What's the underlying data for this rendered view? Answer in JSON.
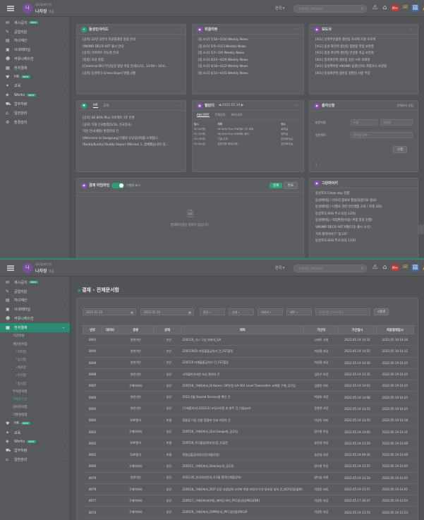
{
  "top": {
    "org": "재무통제/인증",
    "user_name": "나차장",
    "user_rank": "차장",
    "avatar_text": "나",
    "lang": "한국",
    "search_placeholder": "검색어를 입력하세요",
    "badge_count": "99+"
  },
  "sidebar1": [
    {
      "icon": "board-icon",
      "glyph": "✉",
      "label": "게시공지",
      "new": "NEW"
    },
    {
      "icon": "pencil-icon",
      "glyph": "✎",
      "label": "공업지원",
      "new": ""
    },
    {
      "icon": "chart-icon",
      "glyph": "▤",
      "label": "자녀계산",
      "new": ""
    },
    {
      "icon": "folder-icon",
      "glyph": "▣",
      "label": "사내레터널",
      "new": ""
    },
    {
      "icon": "people-icon",
      "glyph": "☻",
      "label": "커뮤니케이션",
      "new": ""
    },
    {
      "icon": "doc-icon",
      "glyph": "▦",
      "label": "전자결재",
      "new": ""
    },
    {
      "icon": "hr-icon",
      "glyph": "♥",
      "label": "HR",
      "new": "NEW"
    },
    {
      "icon": "edu-icon",
      "glyph": "✦",
      "label": "교육",
      "new": ""
    },
    {
      "icon": "works-icon",
      "glyph": "◈",
      "label": "Works",
      "new": "NEW"
    },
    {
      "icon": "car-icon",
      "glyph": "⛟",
      "label": "업무차량",
      "new": ""
    },
    {
      "icon": "building-icon",
      "glyph": "⌂",
      "label": "일반관리",
      "new": ""
    },
    {
      "icon": "settings-icon",
      "glyph": "⚙",
      "label": "환경관리",
      "new": ""
    }
  ],
  "cards": {
    "notice": {
      "title": "동성인사이드",
      "items": [
        "[공지] 22년 상반기 미운올해정 알림 안내",
        "VIKUNR DECO ART 출시 안내",
        "[공지] 다이아트 리뉴얼 안내",
        "[알림] 포장 알림",
        "[Chemical BU] 부산공장 정방 작업 안내(1/11, 13:00~ 16:0...",
        "[공지] 동성테크 Green Board 발행_4월"
      ]
    },
    "weekly": {
      "title": "위클리뷰",
      "items": [
        "[동.A.O] 5/16~5/20 Weekly News",
        "[동.A.O] 5/9~5/13 Weekly News",
        "[동.A.O] 5/2~5/6 Weekly News",
        "[동.A.O] 4/25~4/29 Weekly News",
        "[동.A.O] 4/18~4/22 Weekly News",
        "[동.A.O] 4/11~4/15 Weekly News"
      ]
    },
    "press": {
      "title": "보도사",
      "items": [
        "[보도] 산학부산협력 생산팀 자사팩 지원 프로젝",
        "[보도] 동성 화인텍 생산팀 함정량 작업 보관원",
        "[보도] 동성 화인텍 생산팀 안성용 지금 보관실",
        "[보도] 동성화인텍 생산팀 김선 시유 모바일",
        "[보도] 동성케미칼 VIKUNR 숨결(신뢰) 최종코시 보관원",
        "[보도] 동성화인텍 생산팀 김영일 사용 부양"
      ]
    },
    "hr": {
      "title": "HR",
      "tab1": "HR",
      "tab2": "교육",
      "items": [
        "[공지] SK 80% Plus 프로젝트 T/F 운영",
        "[공지] 직원 인사발령(5/16, 신규입사)",
        "직원 인사(채용) 발령안내 건",
        "[Welcome to Dongsung] 5월의 신규입사자를 소개합니...",
        "[BuddyBuddy] Buddy Report (Mission 1, 함께했습니다) 중..."
      ]
    },
    "schedule": {
      "title": "캘린더",
      "date": "2022.05.19",
      "tabs": [
        "Add OOF",
        "전체일정",
        "회의/교육"
      ],
      "headers": [
        "일시",
        "제목",
        "장소"
      ],
      "rows": [
        [
          "05.19(목)",
          "SK 80% Plus 프로젝트 T/F 회의",
          "회의실"
        ],
        [
          "05.19(목)",
          "SK 80% Plus 프로젝트 회의",
          "회의실"
        ],
        [
          "05.19(목)",
          "기술 주제",
          "본관회의실"
        ],
        [
          "05.20(금)",
          "경영기획 회의(2층)",
          "본관회의실"
        ]
      ]
    },
    "visitor": {
      "title": "출자신청",
      "link": "전체보기 신청",
      "l1": "방문자명",
      "l2": "방문목적",
      "p1": "이름",
      "p2": "업체명",
      "p3": "목적을 입력",
      "submit": "신청",
      "note": "1"
    },
    "approval": {
      "title": "결재 타임라인",
      "toggle_label": "진행중 표시",
      "btn1": "결재",
      "btn2": "완료",
      "empty": "결재대기중인 항목이 없습니다."
    },
    "green": {
      "title": "그린마이키",
      "items": [
        "동성TCS Clean day 진행",
        "동성에이팀 / 리프리 종료로 월동(동절기로 종료)",
        "동성에이팀 / 나행사 관련 안전생활 교육 / 과제 교육)",
        "동성TCS EHS 주소식(등 12차)",
        "동성에이팀 / 작업환경(이용) 위험 알림 진행)",
        "VIKUNR DECO ART 9월(1차) 출시 소식)",
        "가족 행복이야기 \"칭고로\"",
        "동성TCS EHS 주소식(등 11차)"
      ]
    }
  },
  "sidebar2": {
    "top_items": [
      {
        "icon": "board-icon",
        "glyph": "✉",
        "label": "게시공지",
        "new": "NEW"
      },
      {
        "icon": "pencil-icon",
        "glyph": "✎",
        "label": "공업지원",
        "new": ""
      },
      {
        "icon": "chart-icon",
        "glyph": "▤",
        "label": "자녀계산",
        "new": ""
      },
      {
        "icon": "folder-icon",
        "glyph": "▣",
        "label": "사내레터널",
        "new": ""
      },
      {
        "icon": "people-icon",
        "glyph": "☻",
        "label": "커뮤니케이션",
        "new": ""
      }
    ],
    "active": {
      "icon": "doc-icon",
      "glyph": "▦",
      "label": "전자결재"
    },
    "subs": [
      {
        "label": "기안작성",
        "level": 1,
        "green": false
      },
      {
        "label": "개인문서함",
        "level": 1,
        "green": false
      },
      {
        "label": "처리함",
        "level": 2,
        "green": false
      },
      {
        "label": "상신함",
        "level": 2,
        "green": false
      },
      {
        "label": "배포함",
        "level": 2,
        "green": false
      },
      {
        "label": "수신함",
        "level": 2,
        "green": false
      },
      {
        "label": "참시함",
        "level": 2,
        "green": false
      },
      {
        "label": "부서문서함",
        "level": 1,
        "green": false
      },
      {
        "label": "전체문서함",
        "level": 1,
        "green": true
      },
      {
        "label": "감사문서함",
        "level": 1,
        "green": false
      },
      {
        "label": "기본설정함",
        "level": 1,
        "green": false
      }
    ],
    "bottom_items": [
      {
        "icon": "hr-icon",
        "glyph": "♥",
        "label": "HR",
        "new": "NEW"
      },
      {
        "icon": "edu-icon",
        "glyph": "✦",
        "label": "교육",
        "new": ""
      },
      {
        "icon": "works-icon",
        "glyph": "◈",
        "label": "Works",
        "new": "NEW"
      },
      {
        "icon": "car-icon",
        "glyph": "⛟",
        "label": "업무차량",
        "new": ""
      },
      {
        "icon": "building-icon",
        "glyph": "⌂",
        "label": "일반관리",
        "new": ""
      }
    ]
  },
  "doclist": {
    "title": "결재 - 전체문서함",
    "date_from": "2022.01.19",
    "date_to": "2022.05.19",
    "f_type": "종류",
    "f_status": "상태",
    "f_dept": "대외비",
    "f_field": "제목",
    "search_placeholder": "검색어를 입력하세요",
    "search_btn": "검색",
    "headers": [
      "번호",
      "대외비",
      "종류",
      "상태",
      "제목",
      "기안자",
      "기안일시",
      "최종결재일시"
    ],
    "rows": [
      [
        "8091",
        "",
        "일반기안",
        "승인",
        "220519_가스 구입 의뢰서_QA",
        "고재우 사원",
        "2022.05.19 14:31",
        "2022.05.19 14:36"
      ],
      [
        "8090",
        "",
        "일반기안",
        "승인",
        "220519(D) 자동출출금처리 건_FST출장",
        "허성철 과장",
        "2022.05.19 14:25",
        "2022.05.19 14:31"
      ],
      [
        "8089",
        "",
        "일반기안",
        "승인",
        "220519 자재출출금처리 건_FST출장",
        "허성철 과장",
        "2022.05.19 14:30",
        "2022.05.19 14:25"
      ],
      [
        "8088",
        "",
        "일반기안",
        "승인",
        "고객불만처리한 보상 품의의 건",
        "김준우 부장",
        "2022.05.19 13:35",
        "2022.05.19 14:25"
      ],
      [
        "8087",
        "",
        "구매의뢰서",
        "승인",
        "220518_구매의뢰서_IS Korea / OP유정 UA-302 Level Transmitter 교체용 구매_공무팀",
        "김종민 대리",
        "2022.05.19 14:01",
        "2022.05.19 14:25"
      ],
      [
        "8086",
        "",
        "일반기안",
        "승인",
        "2022 4월 Shared Service용 확인 건",
        "박경호 과장",
        "2022.05.19 14:08",
        "2022.05.19 14:25"
      ],
      [
        "8085",
        "",
        "일반기안",
        "승인",
        "[구매품의서] 2022(3) 코딩소모품 외 발주 건_이동part",
        "윤종현 과장",
        "2022.05.19 13:52",
        "2022.05.19 14:25"
      ],
      [
        "8084",
        "",
        "SAP품의",
        "미결",
        "정품류 이동 신용 용품에 인쇄 과정의 건",
        "이상민 대리",
        "2022.05.19 13:50",
        "2022.05.19 14:18"
      ],
      [
        "8083",
        "",
        "구매의뢰서",
        "승인",
        "220516_구매의뢰서_Dial Gauge외_공무팀",
        "정우창 주임",
        "2022.05.19 14:00",
        "2022.05.19 14:11"
      ],
      [
        "8082",
        "",
        "SAP품의",
        "미결",
        "220519_주식출입(외부)인증_유류운",
        "송준영 과장",
        "2022.05.19 13:29",
        "2022.05.19 14:09"
      ],
      [
        "8081",
        "",
        "SAP품의",
        "미결",
        "정밀입출금(외부인증/4월신업)",
        "송준영 과장",
        "2022.05.19 09:34",
        "2022.05.19 14:09"
      ],
      [
        "8080",
        "",
        "구매의뢰서",
        "승인",
        "220511_구매의뢰서_Bearing 외_공무팀",
        "정우창 주임",
        "2022.05.19 13:55",
        "2022.05.19 14:04"
      ],
      [
        "8079",
        "",
        "일반기안",
        "승인",
        "2022.05_한국자신인처_4.5물 협작단체품(2차)",
        "양다솜 사원",
        "2022.05.19 13:18",
        "2022.05.19 14:05"
      ],
      [
        "8078",
        "",
        "구매의뢰서",
        "승인",
        "220518_구매의뢰서_DCP 공장 사업업에 사기화 위험 보완의 우선 방호망 설치 건_DCP공장(물화)",
        "이준민 대리",
        "2022.05.19 13:51",
        "2022.05.19 14:01"
      ],
      [
        "8077",
        "",
        "구매의뢰서",
        "승인",
        "220517_구매의뢰서(4개)_베어링 외의_PFC생산팀(PEG)[BK]",
        "이광민 과장",
        "2022.05.17 16:47",
        "2022.05.19 13:54"
      ],
      [
        "8076",
        "",
        "구매의뢰서",
        "승인",
        "220519_구매의뢰서_OIRM부서_PFC생산팀(PEG)P",
        "이광민 과장",
        "2022.05.19 13:53",
        "2022.05.19 13:53"
      ],
      [
        "8075",
        "",
        "일반기안",
        "승인",
        "전국 최적화방안 구축22(4.19)개선방안(2관)",
        "이광민 과장",
        "2022.05.19 11:48",
        "2022.05.19 13:53"
      ]
    ]
  }
}
